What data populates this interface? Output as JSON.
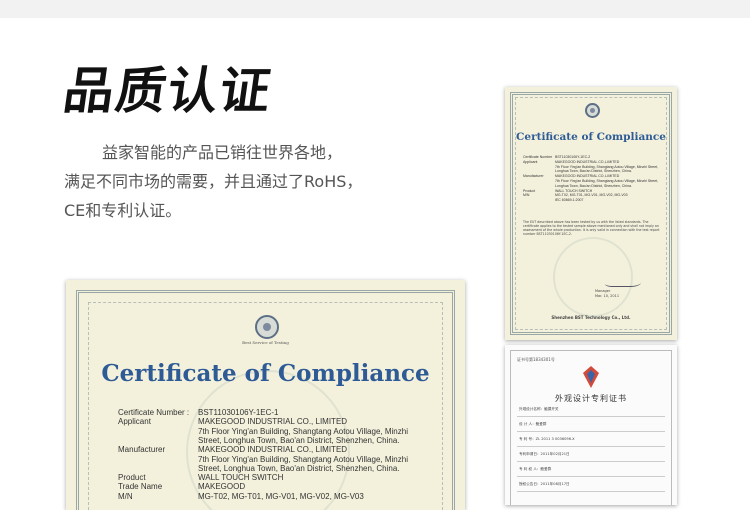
{
  "heading": "品质认证",
  "description": {
    "line1": "益家智能的产品已销往世界各地，",
    "line2": "满足不同市场的需要，并且通过了RoHS，",
    "line3": "CE和专利认证。"
  },
  "cert_main": {
    "caption": "Best Service of Testing",
    "title": "Certificate of Compliance",
    "rows": [
      {
        "label": "Certificate Number :",
        "value": "BST11030106Y-1EC-1"
      },
      {
        "label": "Applicant",
        "value": "MAKEGOOD INDUSTRIAL CO., LIMITED"
      },
      {
        "label": "",
        "value": "7th Floor Ying'an Building, Shangtang Aotou Village, Minzhi"
      },
      {
        "label": "",
        "value": "Street, Longhua Town, Bao'an District, Shenzhen, China."
      },
      {
        "label": "Manufacturer",
        "value": "MAKEGOOD INDUSTRIAL CO., LIMITED"
      },
      {
        "label": "",
        "value": "7th Floor Ying'an Building, Shangtang Aotou Village, Minzhi"
      },
      {
        "label": "",
        "value": "Street, Longhua Town, Bao'an District, Shenzhen, China."
      },
      {
        "label": "Product",
        "value": "WALL TOUCH SWITCH"
      },
      {
        "label": "Trade Name",
        "value": "MAKEGOOD"
      },
      {
        "label": "M/N",
        "value": "MG-T02, MG-T01, MG-V01, MG-V02, MG-V03"
      }
    ]
  },
  "cert_small": {
    "title": "Certificate of Compliance",
    "rows": [
      {
        "label": "Certificate Number",
        "value": "BST11030106Y-1EC-2"
      },
      {
        "label": "Applicant",
        "value": "MAKEGOOD INDUSTRIAL CO.,LIMITED"
      },
      {
        "label": "",
        "value": "7th Floor Ying'an Building, Shangtang Aotou Village, Minzhi Street,"
      },
      {
        "label": "",
        "value": "Longhua Town, Bao'an District, Shenzhen, China."
      },
      {
        "label": "Manufacturer",
        "value": "MAKEGOOD INDUSTRIAL CO.,LIMITED"
      },
      {
        "label": "",
        "value": "7th Floor Ying'an Building, Shangtang Aotou Village, Minzhi Street,"
      },
      {
        "label": "",
        "value": "Longhua Town, Bao'an District, Shenzhen, China."
      },
      {
        "label": "Product",
        "value": "WALL TOUCH SWITCH"
      },
      {
        "label": "M/N",
        "value": "MG-T02, MG-T01, MG-V01, MG-V02, MG-V03"
      },
      {
        "label": "",
        "value": "IEC 60669-1:2007"
      }
    ],
    "paragraph": "The EUT described above has been tested by us with the listed standards. The certificate applies to the tested sample above mentioned only and shall not imply an assessment of the whole production. It is only valid in connection with the test report number BST11030106Y-1EC-2.",
    "signer": "Manager",
    "date": "Mar. 10, 2011",
    "issuer": "Shenzhen BST Technology Co., Ltd."
  },
  "patent": {
    "top_text": "证书号第1834301号",
    "title": "外观设计专利证书",
    "lines": [
      "外观设计名称：触摸开关",
      "设 计 人：鲍爱群",
      "专 利 号：ZL 2011 3 0036096.X",
      "专利申请日：2011年02月21日",
      "专 利 权 人：鲍爱群",
      "授权公告日：2011年08月17日"
    ]
  },
  "colors": {
    "title_blue": "#2e5b96",
    "cert_bg": "#f3f1dc",
    "text_gray": "#555555"
  }
}
